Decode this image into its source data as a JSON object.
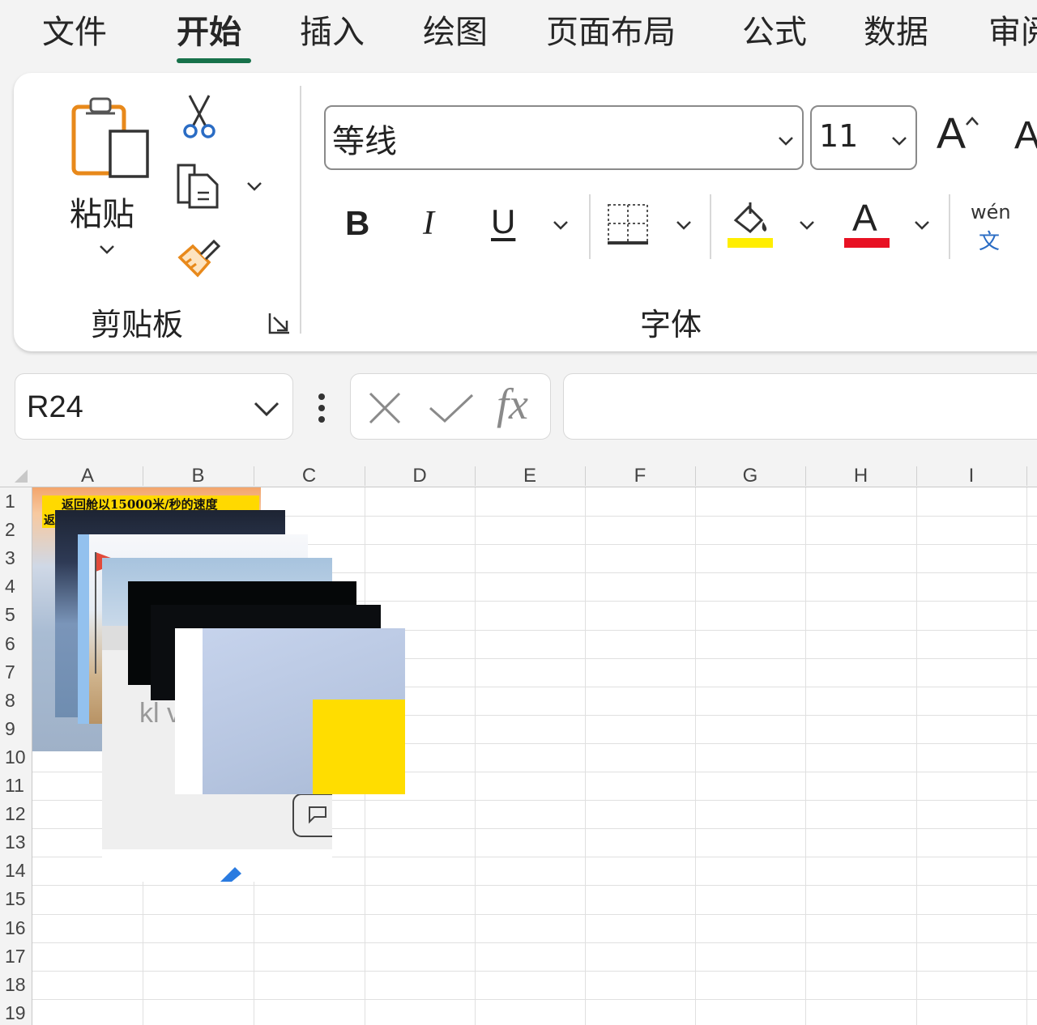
{
  "tabs": [
    {
      "label": "文件",
      "active": false
    },
    {
      "label": "开始",
      "active": true
    },
    {
      "label": "插入",
      "active": false
    },
    {
      "label": "绘图",
      "active": false
    },
    {
      "label": "页面布局",
      "active": false
    },
    {
      "label": "公式",
      "active": false
    },
    {
      "label": "数据",
      "active": false
    },
    {
      "label": "审阅",
      "active": false
    }
  ],
  "clipboard": {
    "paste_label": "粘贴",
    "group_label": "剪贴板"
  },
  "font": {
    "name": "等线",
    "size": "11",
    "group_label": "字体",
    "grow_label": "A",
    "shrink_label": "A",
    "bold": "B",
    "italic": "I",
    "underline": "U",
    "font_color_letter": "A",
    "phonetic_top": "wén",
    "phonetic_bottom": "文",
    "fill_color": "#ffee00",
    "font_color": "#e81123"
  },
  "formula_bar": {
    "name_box": "R24",
    "formula": "",
    "fx": "fx"
  },
  "grid": {
    "columns": [
      "A",
      "B",
      "C",
      "D",
      "E",
      "F",
      "G",
      "H",
      "I"
    ],
    "rows": [
      "1",
      "2",
      "3",
      "4",
      "5",
      "6",
      "7",
      "8",
      "9",
      "10",
      "11",
      "12",
      "13",
      "14",
      "15",
      "16",
      "17",
      "18",
      "19"
    ]
  },
  "picture1": {
    "caption_line1": "返回舱以15000米/秒的速度",
    "caption_line2": "返"
  },
  "picture6": {
    "partial_text": "kl v"
  },
  "colors": {
    "accent": "#17714a",
    "yellow": "#ffdd00"
  }
}
